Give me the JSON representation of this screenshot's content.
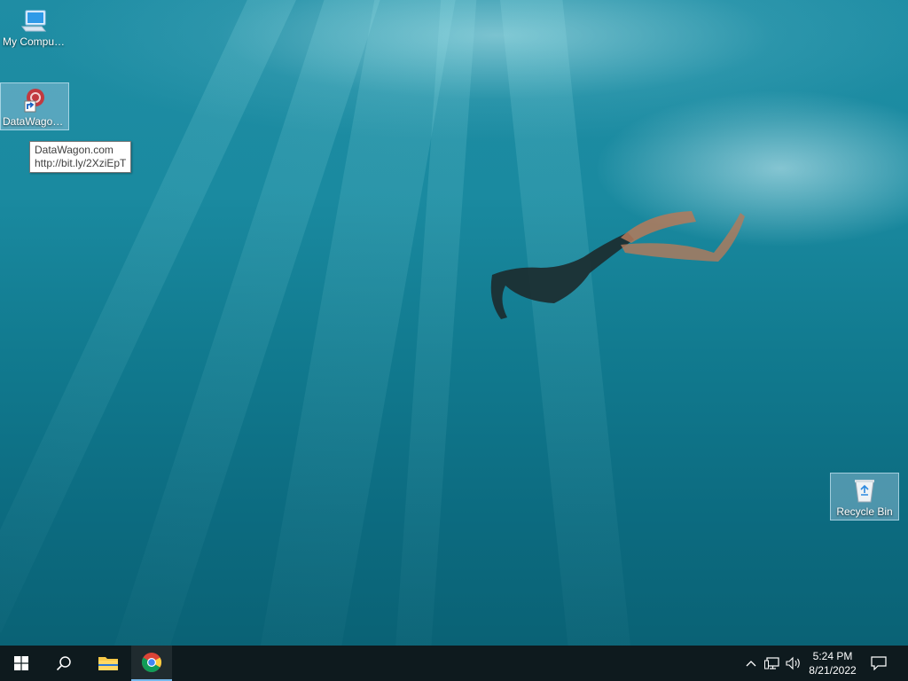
{
  "desktop": {
    "icons": [
      {
        "label": "My Computer",
        "icon": "computer-icon"
      },
      {
        "label": "DataWagon...",
        "icon": "datawagon-shortcut-icon"
      },
      {
        "label": "Recycle Bin",
        "icon": "recycle-bin-icon"
      }
    ],
    "tooltip": {
      "line1": "DataWagon.com",
      "line2": "http://bit.ly/2XziEpT"
    }
  },
  "taskbar": {
    "start": "windows-start-icon",
    "search": "search-icon",
    "apps": [
      {
        "name": "file-explorer-icon"
      },
      {
        "name": "chrome-icon",
        "active": true
      }
    ],
    "tray": {
      "chevron": "chevron-up-icon",
      "network": "network-icon",
      "volume": "volume-icon",
      "time": "5:24 PM",
      "date": "8/21/2022",
      "notifications": "notification-icon"
    }
  },
  "colors": {
    "taskbar": "#0e1a1e",
    "water": "#117a8f",
    "accent": "#76b9ed"
  }
}
